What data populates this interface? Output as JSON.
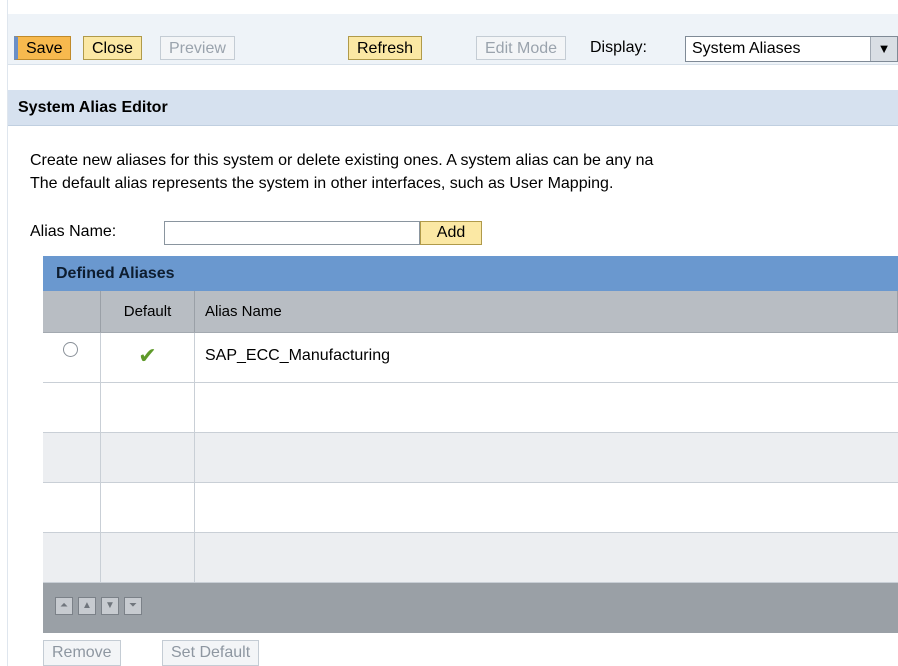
{
  "toolbar": {
    "save_label": "Save",
    "close_label": "Close",
    "preview_label": "Preview",
    "refresh_label": "Refresh",
    "edit_mode_label": "Edit Mode",
    "display_label": "Display:",
    "display_value": "System Aliases"
  },
  "section": {
    "title": "System Alias Editor"
  },
  "description": {
    "line1": "Create new aliases for this system or delete existing ones. A system alias can be any na",
    "line2": "The default alias represents the system in other interfaces, such as User Mapping."
  },
  "alias_form": {
    "label": "Alias Name:",
    "value": "",
    "add_label": "Add"
  },
  "table": {
    "title": "Defined Aliases",
    "columns": [
      "",
      "Default",
      "Alias Name"
    ],
    "rows": [
      {
        "default": "✔",
        "alias_name": "SAP_ECC_Manufacturing"
      },
      {
        "default": "",
        "alias_name": ""
      },
      {
        "default": "",
        "alias_name": ""
      },
      {
        "default": "",
        "alias_name": ""
      },
      {
        "default": "",
        "alias_name": ""
      }
    ]
  },
  "footer": {
    "remove_label": "Remove",
    "set_default_label": "Set Default"
  },
  "icons": {
    "first": "first-page-icon",
    "prev": "previous-page-icon",
    "next": "next-page-icon",
    "last": "last-page-icon"
  },
  "colors": {
    "accent_button": "#fbe8a4",
    "save_button": "#f7b94e",
    "table_header": "#6a98cf",
    "checkmark": "#5f9a2a"
  }
}
